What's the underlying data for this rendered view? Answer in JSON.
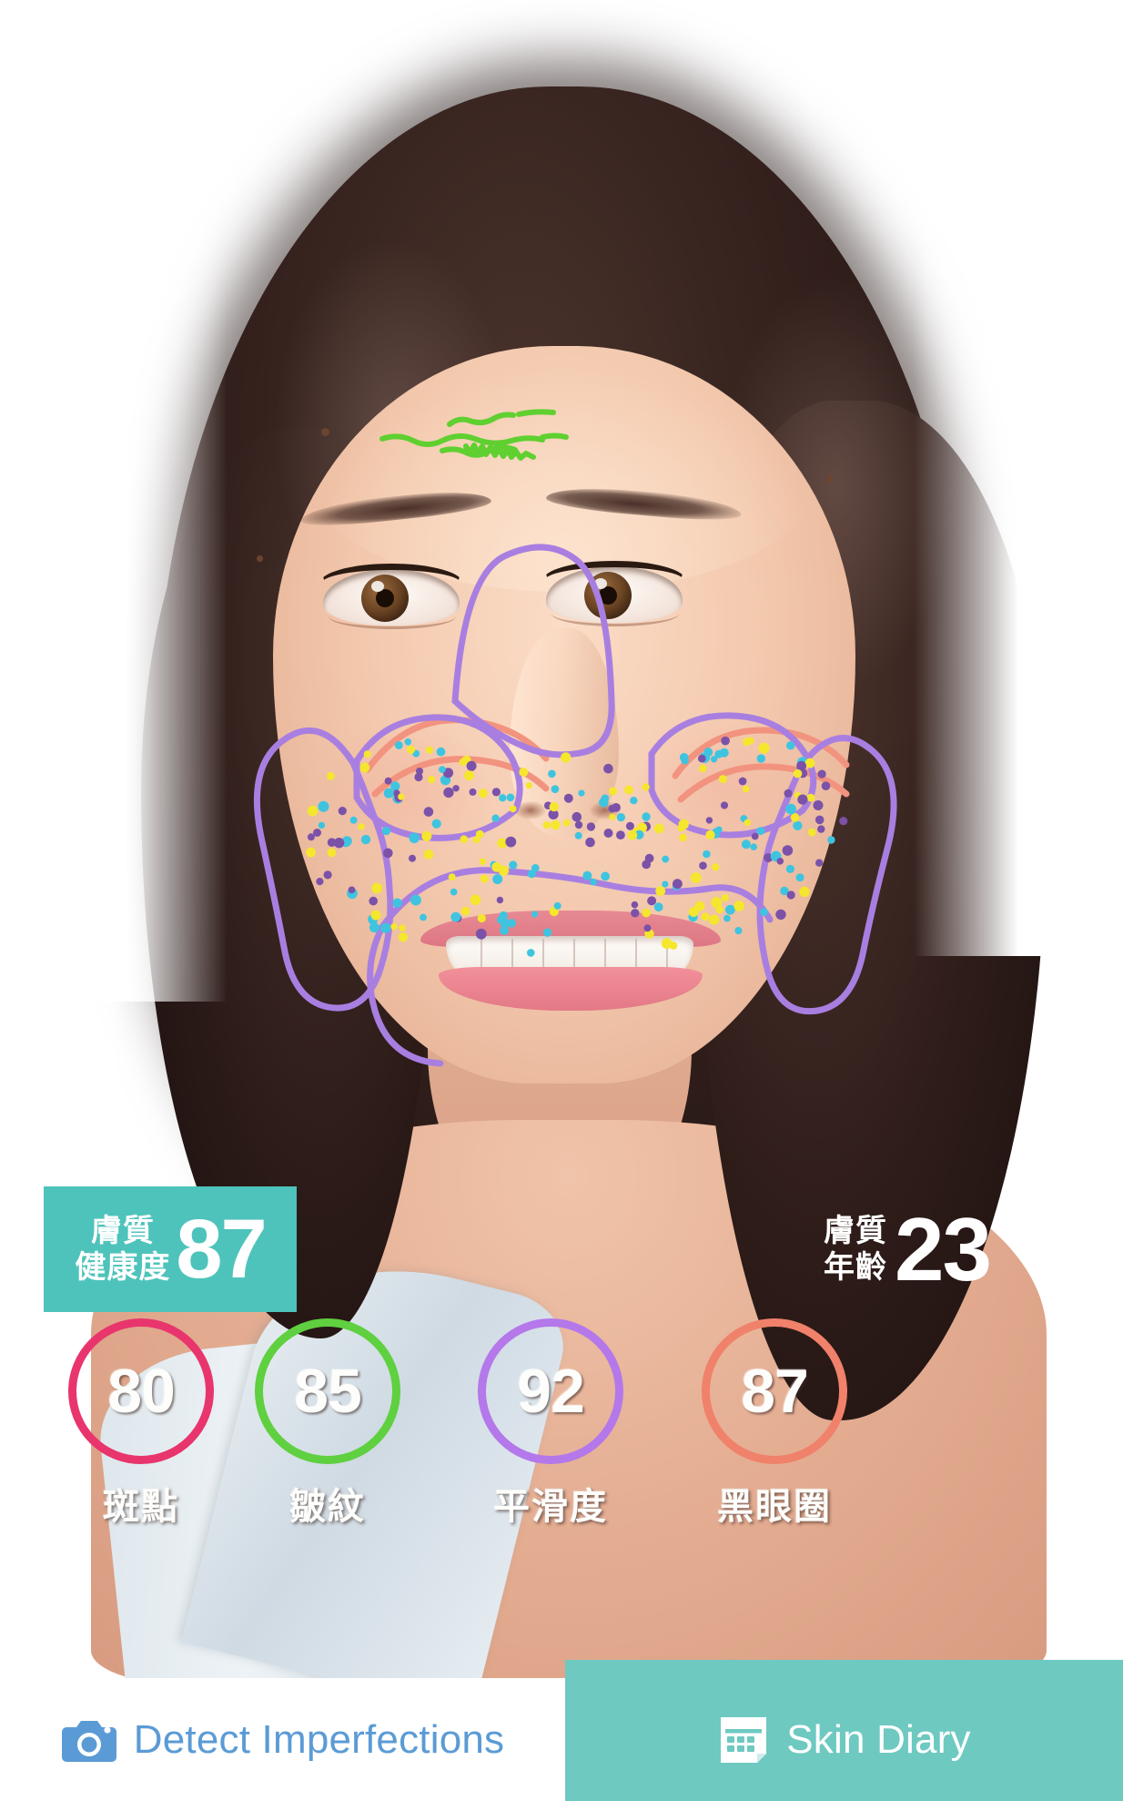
{
  "app": {
    "kind": "skin-analysis-result",
    "accent_teal": "#4ec3bb",
    "toolbar_teal": "#6ec9c1",
    "detect_blue": "#5b9bd5"
  },
  "health_badge": {
    "label_line1": "膚質",
    "label_line2": "健康度",
    "score": "87",
    "background": "#4ec3bb",
    "text_color": "#ffffff"
  },
  "age_badge": {
    "label_line1": "膚質",
    "label_line2": "年齡",
    "score": "23",
    "text_color": "#ffffff"
  },
  "metrics": [
    {
      "score": "80",
      "label": "斑點",
      "ring_color": "#e8356d",
      "name": "spots"
    },
    {
      "score": "85",
      "label": "皺紋",
      "ring_color": "#5fd040",
      "name": "wrinkles"
    },
    {
      "score": "92",
      "label": "平滑度",
      "ring_color": "#b478ea",
      "name": "smoothness"
    },
    {
      "score": "87",
      "label": "黑眼圈",
      "ring_color": "#f0816a",
      "name": "dark-circles"
    }
  ],
  "overlay": {
    "wrinkle_line_color": "#5fd030",
    "spot_zone_outline_color": "#a87fe0",
    "dark_circle_line_color": "#f2937f",
    "spot_dot_colors": [
      "#7b52a8",
      "#f5e62e",
      "#3fc4e0"
    ]
  },
  "toolbar": {
    "detect": {
      "label": "Detect Imperfections",
      "icon": "camera-icon",
      "text_color": "#5b9bd5",
      "background": "#ffffff"
    },
    "diary": {
      "label": "Skin Diary",
      "icon": "calendar-icon",
      "text_color": "#ffffff",
      "background": "#6ec9c1"
    }
  }
}
